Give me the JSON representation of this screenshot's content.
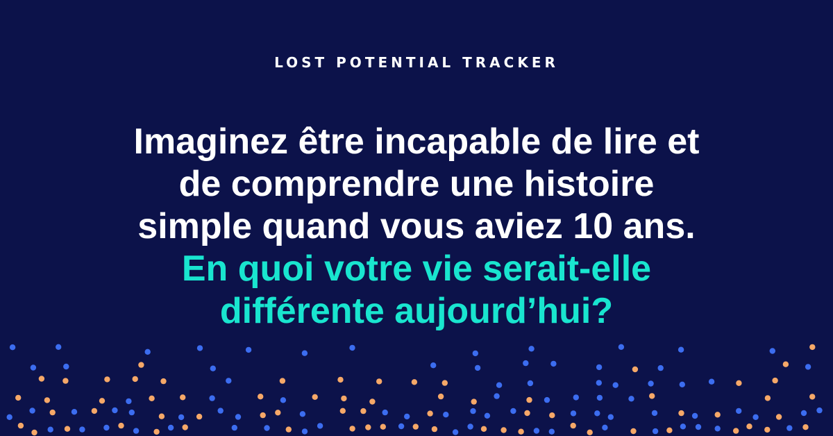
{
  "eyebrow": "LOST POTENTIAL TRACKER",
  "headline": {
    "white_lines": [
      "Imaginez être incapable de lire et",
      "de comprendre une histoire",
      "simple quand vous aviez 10 ans."
    ],
    "accent_lines": [
      "En quoi votre vie serait-elle",
      "différente aujourd’hui?"
    ]
  },
  "colors": {
    "background": "#0c124a",
    "text_primary": "#ffffff",
    "text_accent": "#19e5cf",
    "dot_blue": "#3c6df0",
    "dot_orange": "#f6a868"
  }
}
